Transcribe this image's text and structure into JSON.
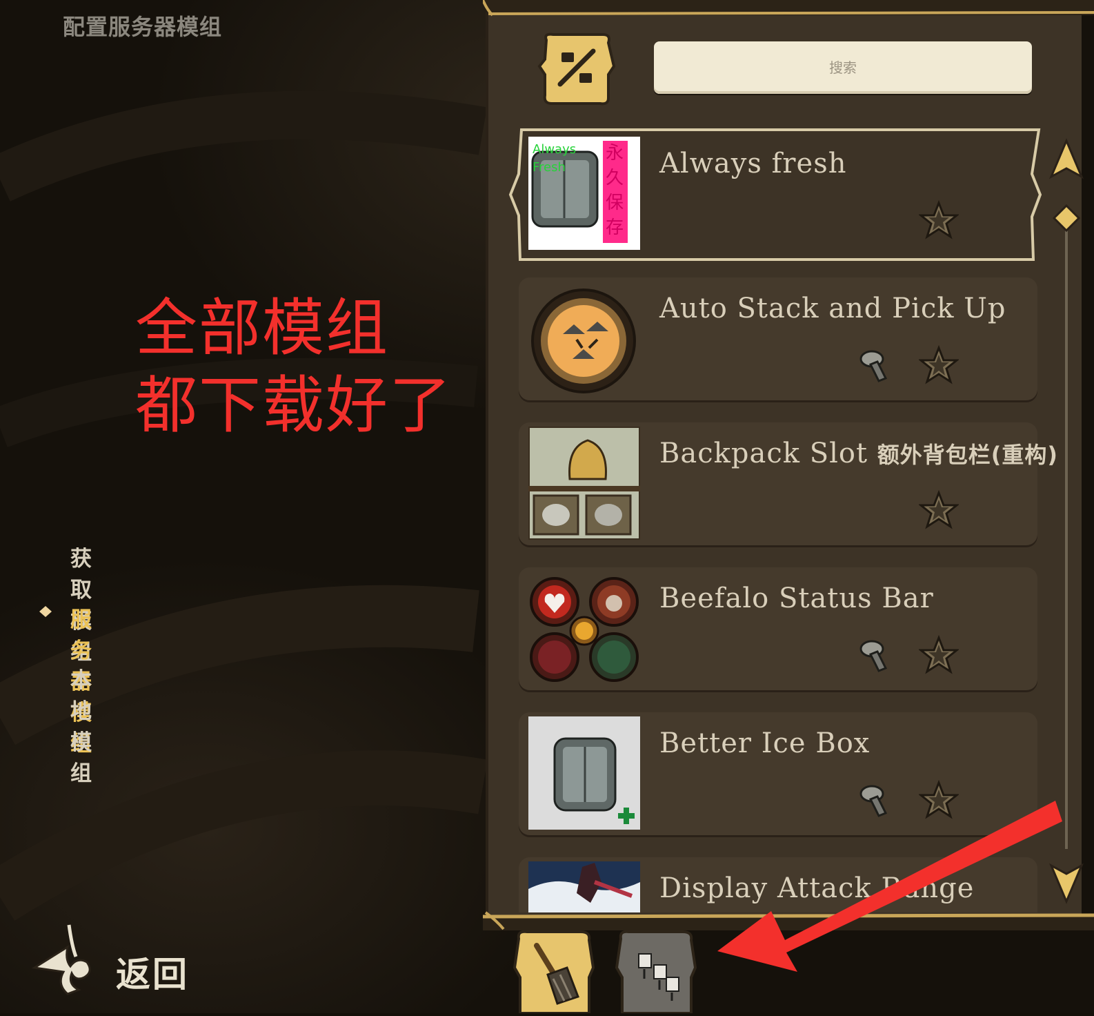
{
  "screen": {
    "title": "配置服务器模组"
  },
  "annotation": {
    "line1": "全部模组",
    "line2": "都下载好了",
    "color": "#f3302c"
  },
  "nav": {
    "items": [
      {
        "label": "获取模组",
        "active": false
      },
      {
        "label": "服务器模组",
        "active": true
      },
      {
        "label": "本地模组",
        "active": false
      }
    ],
    "active_color": "#ecc256"
  },
  "back": {
    "label": "返回",
    "icon": "back-arrow-icon"
  },
  "toolbar": {
    "filter_icon": "percent-filter-icon",
    "search_placeholder": "搜索"
  },
  "mods": [
    {
      "name": "Always fresh",
      "thumb": "ice-box-always-fresh",
      "thumb_label": "永久保存",
      "thumb_label2": "Always Fresh",
      "client_only": false,
      "selected": true
    },
    {
      "name": "Auto Stack and Pick Up",
      "thumb": "auto-stack-badge",
      "client_only": true,
      "selected": false
    },
    {
      "name": "Backpack Slot",
      "name_cjk": "额外背包栏(重构)",
      "thumb": "backpack-slot",
      "client_only": false,
      "selected": false
    },
    {
      "name": "Beefalo Status Bar",
      "thumb": "beefalo-status-badges",
      "client_only": true,
      "selected": false
    },
    {
      "name": "Better Ice Box",
      "thumb": "better-ice-box",
      "client_only": true,
      "selected": false
    },
    {
      "name": "Display Attack Range",
      "thumb": "attack-range-shark",
      "client_only": false,
      "selected": false
    }
  ],
  "bottom_tabs": [
    {
      "name": "cleanup-tab",
      "icon": "broom-icon",
      "active": true
    },
    {
      "name": "update-all-tab",
      "icon": "download-pins-icon",
      "active": false
    }
  ],
  "colors": {
    "panel": "#3d3326",
    "card": "#453a2c",
    "gold": "#e8c66a",
    "arrow": "#f3302c"
  }
}
